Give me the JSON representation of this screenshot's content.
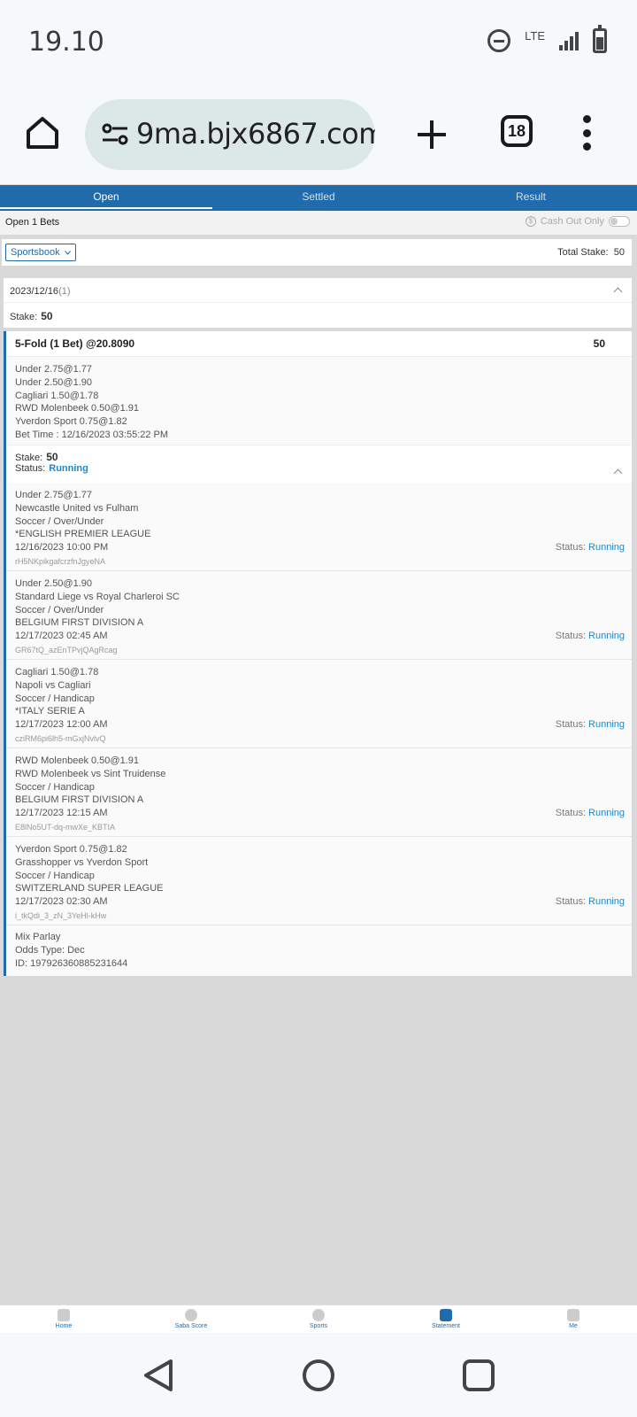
{
  "status_bar": {
    "time": "19.10",
    "network": "LTE"
  },
  "browser": {
    "url": "9ma.bjx6867.com",
    "tab_count": "18"
  },
  "app_tabs": [
    {
      "label": "Open",
      "active": true
    },
    {
      "label": "Settled",
      "active": false
    },
    {
      "label": "Result",
      "active": false
    }
  ],
  "open_bar": {
    "bets_label": "Open 1 Bets",
    "cashout_label": "Cash Out Only"
  },
  "filter": {
    "select_value": "Sportsbook",
    "total_stake_label": "Total Stake:",
    "total_stake_value": "50"
  },
  "date_group": {
    "date": "2023/12/16",
    "count": "(1)",
    "stake_label": "Stake:",
    "stake_value": "50"
  },
  "bet": {
    "title": "5-Fold (1 Bet) @20.8090",
    "amount": "50",
    "summary": [
      "Under 2.75@1.77",
      "Under 2.50@1.90",
      "Cagliari 1.50@1.78",
      "RWD Molenbeek 0.50@1.91",
      "Yverdon Sport 0.75@1.82"
    ],
    "bet_time": "Bet Time : 12/16/2023 03:55:22 PM",
    "stake_label": "Stake:",
    "stake_value": "50",
    "status_label": "Status:",
    "status_value": "Running",
    "legs": [
      {
        "selection": "Under 2.75@1.77",
        "match": "Newcastle United vs Fulham",
        "market": "Soccer / Over/Under",
        "league": "*ENGLISH PREMIER LEAGUE",
        "time": "12/16/2023 10:00 PM",
        "ref": "rH5NKpikgafcrzfnJgyeNA",
        "status_label": "Status:",
        "status": "Running"
      },
      {
        "selection": "Under 2.50@1.90",
        "match": "Standard Liege vs Royal Charleroi SC",
        "market": "Soccer / Over/Under",
        "league": "BELGIUM FIRST DIVISION A",
        "time": "12/17/2023 02:45 AM",
        "ref": "GR67tQ_azEnTPvjQAgRcag",
        "status_label": "Status:",
        "status": "Running"
      },
      {
        "selection": "Cagliari 1.50@1.78",
        "match": "Napoli vs Cagliari",
        "market": "Soccer / Handicap",
        "league": "*ITALY SERIE A",
        "time": "12/17/2023 12:00 AM",
        "ref": "cziRM6pi6lh5-mGxjNvlvQ",
        "status_label": "Status:",
        "status": "Running"
      },
      {
        "selection": "RWD Molenbeek 0.50@1.91",
        "match": "RWD Molenbeek vs Sint Truidense",
        "market": "Soccer / Handicap",
        "league": "BELGIUM FIRST DIVISION A",
        "time": "12/17/2023 12:15 AM",
        "ref": "E8lNo5UT-dq-mwXe_KBTIA",
        "status_label": "Status:",
        "status": "Running"
      },
      {
        "selection": "Yverdon Sport 0.75@1.82",
        "match": "Grasshopper vs Yverdon Sport",
        "market": "Soccer / Handicap",
        "league": "SWITZERLAND SUPER LEAGUE",
        "time": "12/17/2023 02:30 AM",
        "ref": "i_tkQdi_3_zN_3YeHl-kHw",
        "status_label": "Status:",
        "status": "Running"
      }
    ],
    "footer": {
      "type": "Mix Parlay",
      "odds_type": "Odds Type: Dec",
      "id": "ID: 197926360885231644"
    }
  },
  "bottom_nav": [
    {
      "label": "Home",
      "icon": "home-icon",
      "active": false
    },
    {
      "label": "Saba Score",
      "icon": "score-icon",
      "active": false
    },
    {
      "label": "Sports",
      "icon": "soccer-ball-icon",
      "active": false
    },
    {
      "label": "Statement",
      "icon": "statement-icon",
      "active": true
    },
    {
      "label": "Me",
      "icon": "user-icon",
      "active": false
    }
  ],
  "colors": {
    "primary": "#1f6bac",
    "running": "#1f88c8",
    "browser_bg": "#f5f9fb",
    "url_pill": "#dce8e8"
  }
}
